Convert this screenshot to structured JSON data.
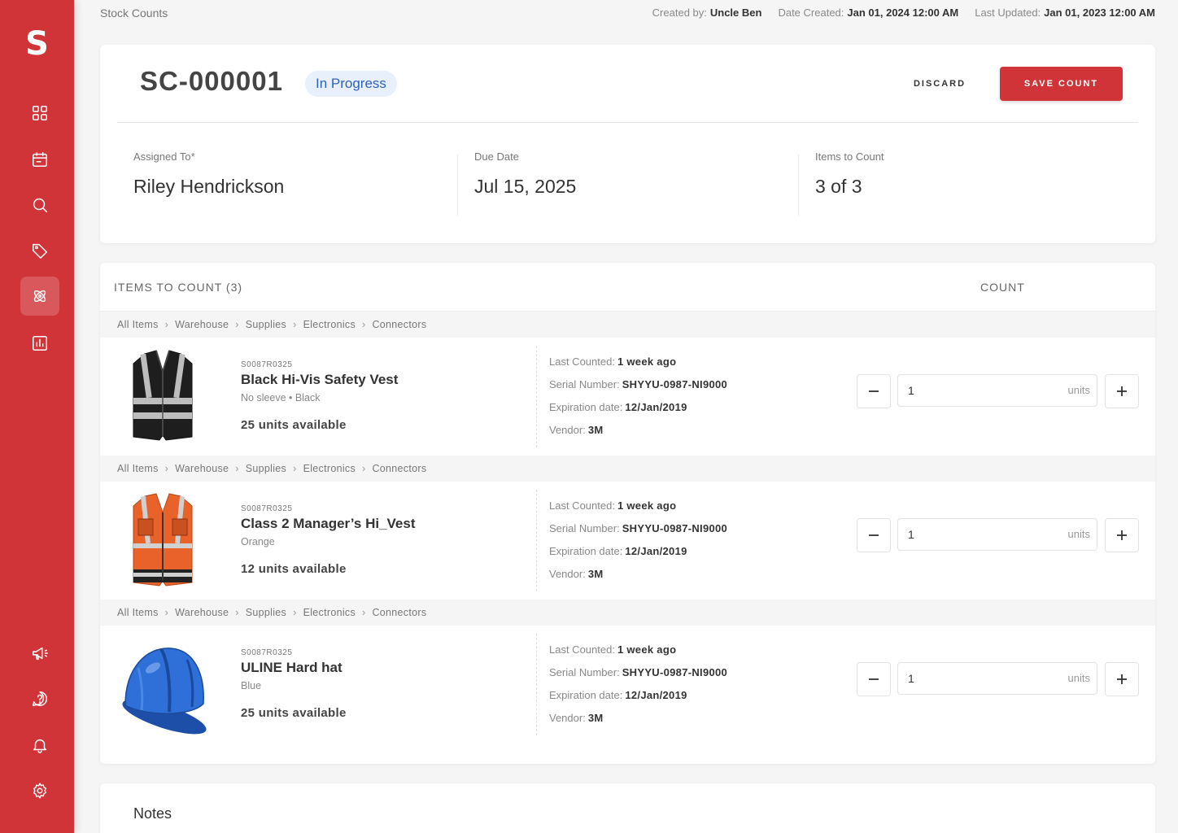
{
  "sidebar": {
    "logo": "S",
    "items": [
      {
        "icon": "dashboard-icon"
      },
      {
        "icon": "calendar-icon"
      },
      {
        "icon": "search-icon"
      },
      {
        "icon": "tags-icon"
      },
      {
        "icon": "stock-count-icon",
        "active": true
      },
      {
        "icon": "reports-icon"
      },
      {
        "icon": "megaphone-icon"
      },
      {
        "icon": "help-icon"
      },
      {
        "icon": "bell-icon"
      },
      {
        "icon": "gear-icon"
      }
    ]
  },
  "topbar": {
    "breadcrumb": "Stock Counts",
    "created_by_label": "Created by:",
    "created_by": "Uncle Ben",
    "date_created_label": "Date Created:",
    "date_created": "Jan 01, 2024 12:00 AM",
    "last_updated_label": "Last Updated:",
    "last_updated": "Jan 01, 2023 12:00 AM"
  },
  "header": {
    "id": "SC-000001",
    "status": "In Progress",
    "discard_label": "DISCARD",
    "save_label": "SAVE COUNT",
    "assigned_label": "Assigned To*",
    "assigned_value": "Riley Hendrickson",
    "due_label": "Due Date",
    "due_value": "Jul 15, 2025",
    "items_label": "Items to Count",
    "items_value": "3 of 3"
  },
  "items_section": {
    "title": "ITEMS TO COUNT (3)",
    "count_header": "COUNT",
    "rows": [
      {
        "path": [
          "All Items",
          "Warehouse",
          "Supplies",
          "Electronics",
          "Connectors"
        ],
        "sku": "S0087R0325",
        "name": "Black Hi-Vis Safety Vest",
        "variant": "No sleeve • Black",
        "available": "25 units available",
        "last_counted_label": "Last Counted:",
        "last_counted": "1 week ago",
        "serial_label": "Serial Number:",
        "serial": "SHYYU-0987-NI9000",
        "expiration_label": "Expiration date:",
        "expiration": "12/Jan/2019",
        "vendor_label": "Vendor:",
        "vendor": "3M",
        "qty": "1",
        "unit": "units",
        "image": "black-vest-image"
      },
      {
        "path": [
          "All Items",
          "Warehouse",
          "Supplies",
          "Electronics",
          "Connectors"
        ],
        "sku": "S0087R0325",
        "name": "Class 2 Manager’s Hi_Vest",
        "variant": "Orange",
        "available": "12 units available",
        "last_counted_label": "Last Counted:",
        "last_counted": "1 week ago",
        "serial_label": "Serial Number:",
        "serial": "SHYYU-0987-NI9000",
        "expiration_label": "Expiration date:",
        "expiration": "12/Jan/2019",
        "vendor_label": "Vendor:",
        "vendor": "3M",
        "qty": "1",
        "unit": "units",
        "image": "orange-vest-image"
      },
      {
        "path": [
          "All Items",
          "Warehouse",
          "Supplies",
          "Electronics",
          "Connectors"
        ],
        "sku": "S0087R0325",
        "name": "ULINE Hard hat",
        "variant": "Blue",
        "available": "25 units available",
        "last_counted_label": "Last Counted:",
        "last_counted": "1 week ago",
        "serial_label": "Serial Number:",
        "serial": "SHYYU-0987-NI9000",
        "expiration_label": "Expiration date:",
        "expiration": "12/Jan/2019",
        "vendor_label": "Vendor:",
        "vendor": "3M",
        "qty": "1",
        "unit": "units",
        "image": "blue-hard-hat-image"
      }
    ]
  },
  "notes": {
    "title": "Notes"
  },
  "colors": {
    "brand": "#d13438",
    "status_bg": "#e8f0fb",
    "status_text": "#2f62b8"
  }
}
